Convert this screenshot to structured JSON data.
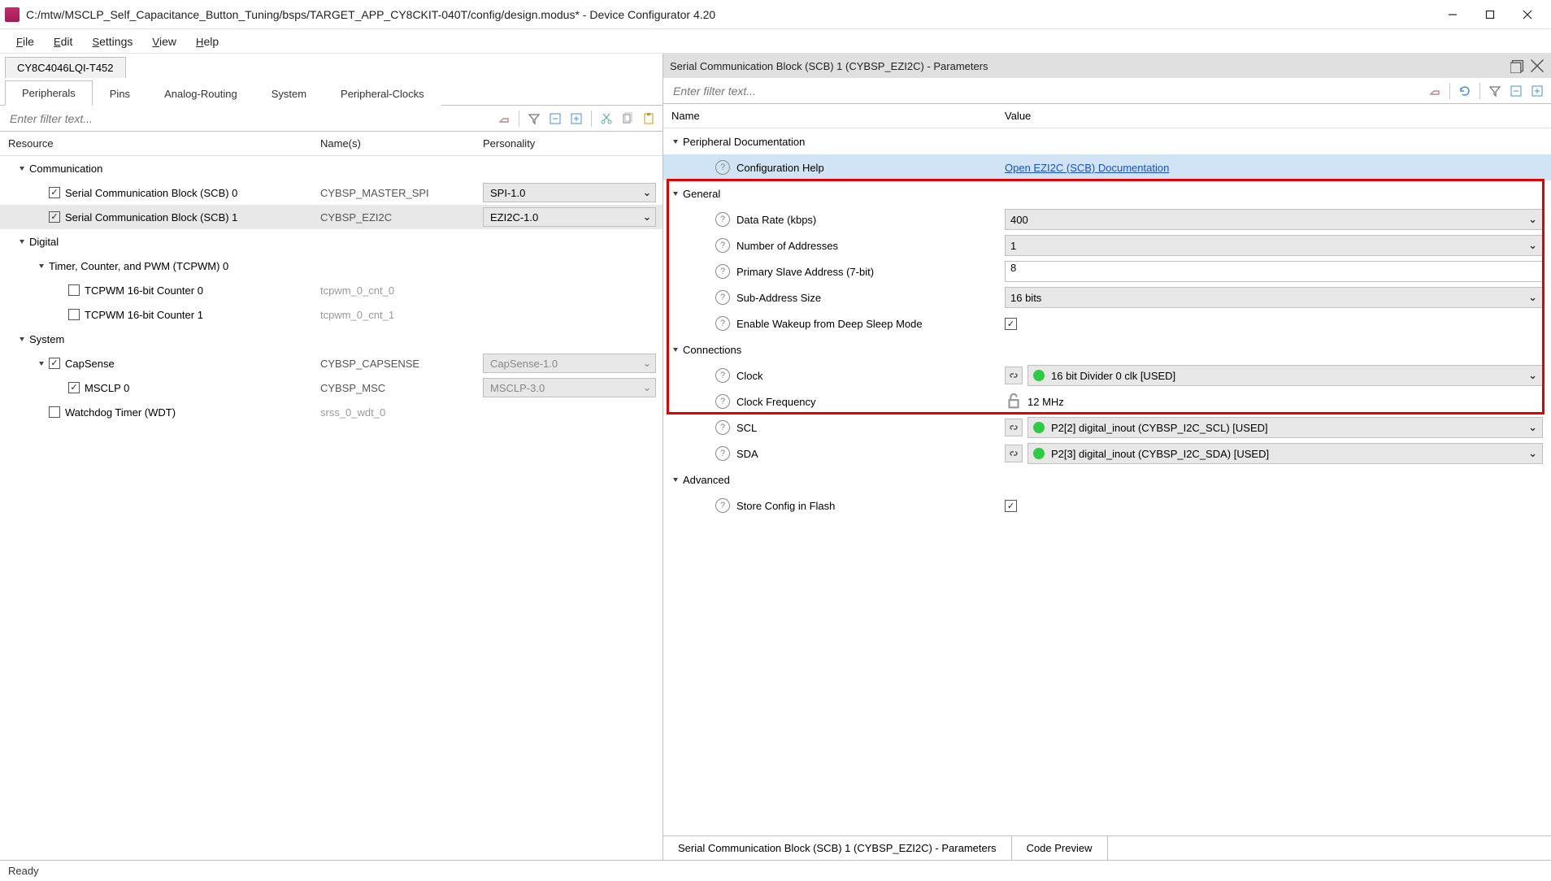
{
  "window": {
    "title": "C:/mtw/MSCLP_Self_Capacitance_Button_Tuning/bsps/TARGET_APP_CY8CKIT-040T/config/design.modus* - Device Configurator 4.20"
  },
  "menu": {
    "items": [
      "File",
      "Edit",
      "Settings",
      "View",
      "Help"
    ]
  },
  "device_tab": "CY8C4046LQI-T452",
  "ptabs": [
    "Peripherals",
    "Pins",
    "Analog-Routing",
    "System",
    "Peripheral-Clocks"
  ],
  "left": {
    "filter_placeholder": "Enter filter text...",
    "hdr": {
      "c1": "Resource",
      "c2": "Name(s)",
      "c3": "Personality"
    },
    "tree": [
      {
        "type": "group",
        "label": "Communication",
        "indent": 0
      },
      {
        "type": "item",
        "label": "Serial Communication Block (SCB) 0",
        "checked": true,
        "indent": 1,
        "name": "CYBSP_MASTER_SPI",
        "pers": "SPI-1.0",
        "dropdown": true
      },
      {
        "type": "item",
        "label": "Serial Communication Block (SCB) 1",
        "checked": true,
        "indent": 1,
        "name": "CYBSP_EZI2C",
        "pers": "EZI2C-1.0",
        "dropdown": true,
        "selected": true
      },
      {
        "type": "group",
        "label": "Digital",
        "indent": 0
      },
      {
        "type": "group",
        "label": "Timer, Counter, and PWM (TCPWM) 0",
        "indent": 1
      },
      {
        "type": "item",
        "label": "TCPWM 16-bit Counter 0",
        "checked": false,
        "indent": 2,
        "name": "tcpwm_0_cnt_0",
        "namemuted": true
      },
      {
        "type": "item",
        "label": "TCPWM 16-bit Counter 1",
        "checked": false,
        "indent": 2,
        "name": "tcpwm_0_cnt_1",
        "namemuted": true
      },
      {
        "type": "group",
        "label": "System",
        "indent": 0
      },
      {
        "type": "item_group",
        "label": "CapSense",
        "checked": true,
        "indent": 1,
        "name": "CYBSP_CAPSENSE",
        "pers": "CapSense-1.0",
        "dropdown": true,
        "disabled": true
      },
      {
        "type": "item",
        "label": "MSCLP 0",
        "checked": true,
        "indent": 2,
        "name": "CYBSP_MSC",
        "pers": "MSCLP-3.0",
        "dropdown": true,
        "disabled": true
      },
      {
        "type": "item",
        "label": "Watchdog Timer (WDT)",
        "checked": false,
        "indent": 1,
        "name": "srss_0_wdt_0",
        "namemuted": true
      }
    ]
  },
  "right": {
    "title": "Serial Communication Block (SCB) 1 (CYBSP_EZI2C) - Parameters",
    "filter_placeholder": "Enter filter text...",
    "hdr": {
      "c1": "Name",
      "c2": "Value"
    },
    "rows": [
      {
        "kind": "group",
        "label": "Peripheral Documentation"
      },
      {
        "kind": "link",
        "label": "Configuration Help",
        "value": "Open EZI2C (SCB) Documentation",
        "selected": true
      },
      {
        "kind": "group",
        "label": "General"
      },
      {
        "kind": "drop",
        "label": "Data Rate (kbps)",
        "value": "400"
      },
      {
        "kind": "drop",
        "label": "Number of Addresses",
        "value": "1"
      },
      {
        "kind": "text",
        "label": "Primary Slave Address (7-bit)",
        "value": "8"
      },
      {
        "kind": "drop",
        "label": "Sub-Address Size",
        "value": "16 bits"
      },
      {
        "kind": "check",
        "label": "Enable Wakeup from Deep Sleep Mode",
        "checked": true
      },
      {
        "kind": "group",
        "label": "Connections"
      },
      {
        "kind": "conn",
        "label": "Clock",
        "value": "16 bit Divider 0 clk [USED]",
        "dot": true
      },
      {
        "kind": "locked",
        "label": "Clock Frequency",
        "value": "12 MHz"
      },
      {
        "kind": "conn",
        "label": "SCL",
        "value": "P2[2] digital_inout (CYBSP_I2C_SCL) [USED]",
        "dot": true
      },
      {
        "kind": "conn",
        "label": "SDA",
        "value": "P2[3] digital_inout (CYBSP_I2C_SDA) [USED]",
        "dot": true
      },
      {
        "kind": "group",
        "label": "Advanced"
      },
      {
        "kind": "check",
        "label": "Store Config in Flash",
        "checked": true
      }
    ],
    "bottom_tabs": [
      "Serial Communication Block (SCB) 1 (CYBSP_EZI2C) - Parameters",
      "Code Preview"
    ]
  },
  "status": "Ready"
}
